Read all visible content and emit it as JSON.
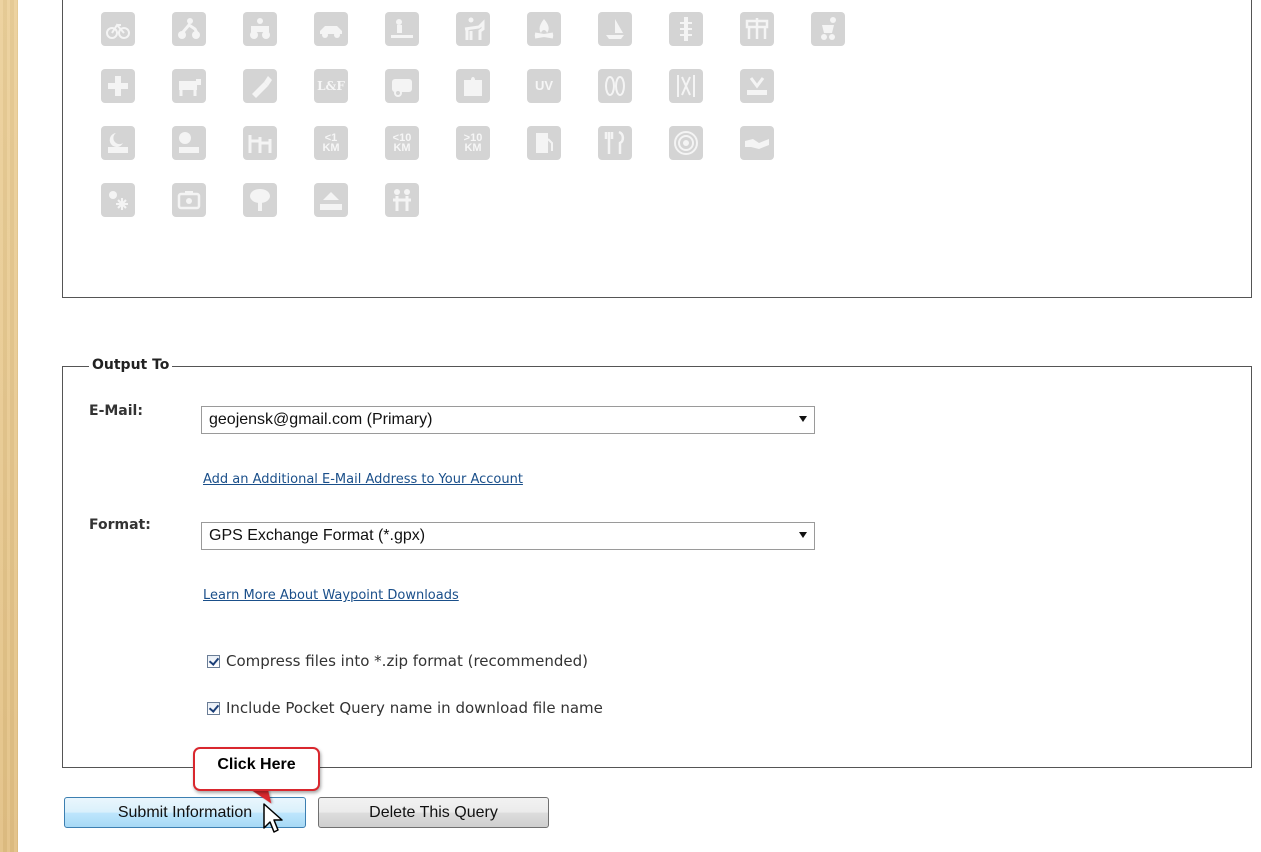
{
  "attribute_icons": [
    [
      "bicycle-icon",
      "motorcycle-icon",
      "quad-icon",
      "off-road-vehicle-icon",
      "snowmobile-icon",
      "horse-icon",
      "campfire-icon",
      "boat-icon",
      "climbing-icon",
      "wheelchair-icon",
      "stroller-icon"
    ],
    [
      "first-aid-icon",
      "cow-icon",
      "flashlight-icon",
      "lost-found-icon",
      "rv-icon",
      "field-puzzle-icon",
      "uv-light-icon",
      "snowshoes-icon",
      "cross-country-skis-icon",
      "tool-icon"
    ],
    [
      "night-cache-icon",
      "parking-icon",
      "stairs-icon",
      "under-1km-icon",
      "under-10km-icon",
      "over-10km-icon",
      "fuel-icon",
      "food-icon",
      "wireless-beacon-icon",
      "partnership-icon"
    ],
    [
      "winter-icon",
      "teamwork-icon",
      "tree-icon",
      "wetlands-icon",
      "kids-icon"
    ]
  ],
  "icon_text": {
    "lost_found": "L&F",
    "uv": "UV",
    "lt1_top": "<1",
    "lt1_bot": "KM",
    "lt10_top": "<10",
    "lt10_bot": "KM",
    "gt10_top": ">10",
    "gt10_bot": "KM"
  },
  "output": {
    "legend": "Output To",
    "email_label": "E-Mail:",
    "email_value": "geojensk@gmail.com (Primary)",
    "add_email_link": "Add an Additional E-Mail Address to Your Account",
    "format_label": "Format:",
    "format_value": "GPS Exchange Format (*.gpx)",
    "learn_more_link": "Learn More About Waypoint Downloads",
    "compress_label": "Compress files into *.zip format (recommended)",
    "compress_checked": true,
    "include_name_label": "Include Pocket Query name in download file name",
    "include_name_checked": true
  },
  "buttons": {
    "submit": "Submit Information",
    "delete": "Delete This Query"
  },
  "callout": {
    "text": "Click Here",
    "border_color": "#d9272e"
  },
  "colors": {
    "link": "#1a4f8a",
    "icon_gray": "#d4d4d4",
    "background": "#e8c98c"
  }
}
